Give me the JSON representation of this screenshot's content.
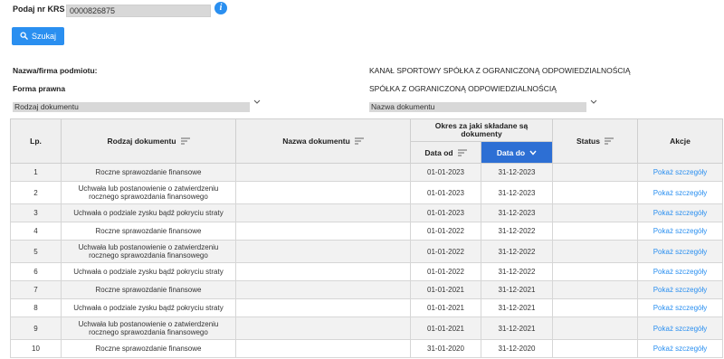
{
  "search": {
    "krs_label": "Podaj nr KRS",
    "krs_value": "0000826875",
    "info_glyph": "i",
    "button_label": "Szukaj"
  },
  "entity": {
    "name_label": "Nazwa/firma podmiotu:",
    "name_value": "KANAŁ SPORTOWY SPÓŁKA Z OGRANICZONĄ ODPOWIEDZIALNOŚCIĄ",
    "legal_form_label": "Forma prawna",
    "legal_form_value": "SPÓŁKA Z OGRANICZONĄ ODPOWIEDZIALNOŚCIĄ"
  },
  "filters": {
    "document_type": "Rodzaj dokumentu",
    "document_name": "Nazwa dokumentu"
  },
  "table": {
    "headers": {
      "lp": "Lp.",
      "type": "Rodzaj dokumentu",
      "name": "Nazwa dokumentu",
      "period": "Okres za jaki składane są dokumenty",
      "date_from": "Data od",
      "date_to": "Data do",
      "status": "Status",
      "actions": "Akcje"
    },
    "rows": [
      {
        "lp": "1",
        "type": "Roczne sprawozdanie finansowe",
        "name": "",
        "date_from": "01-01-2023",
        "date_to": "31-12-2023",
        "status": "",
        "action": "Pokaż szczegóły"
      },
      {
        "lp": "2",
        "type": "Uchwała lub postanowienie o zatwierdzeniu rocznego sprawozdania finansowego",
        "name": "",
        "date_from": "01-01-2023",
        "date_to": "31-12-2023",
        "status": "",
        "action": "Pokaż szczegóły"
      },
      {
        "lp": "3",
        "type": "Uchwała o podziale zysku bądź pokryciu straty",
        "name": "",
        "date_from": "01-01-2023",
        "date_to": "31-12-2023",
        "status": "",
        "action": "Pokaż szczegóły"
      },
      {
        "lp": "4",
        "type": "Roczne sprawozdanie finansowe",
        "name": "",
        "date_from": "01-01-2022",
        "date_to": "31-12-2022",
        "status": "",
        "action": "Pokaż szczegóły"
      },
      {
        "lp": "5",
        "type": "Uchwała lub postanowienie o zatwierdzeniu rocznego sprawozdania finansowego",
        "name": "",
        "date_from": "01-01-2022",
        "date_to": "31-12-2022",
        "status": "",
        "action": "Pokaż szczegóły"
      },
      {
        "lp": "6",
        "type": "Uchwała o podziale zysku bądź pokryciu straty",
        "name": "",
        "date_from": "01-01-2022",
        "date_to": "31-12-2022",
        "status": "",
        "action": "Pokaż szczegóły"
      },
      {
        "lp": "7",
        "type": "Roczne sprawozdanie finansowe",
        "name": "",
        "date_from": "01-01-2021",
        "date_to": "31-12-2021",
        "status": "",
        "action": "Pokaż szczegóły"
      },
      {
        "lp": "8",
        "type": "Uchwała o podziale zysku bądź pokryciu straty",
        "name": "",
        "date_from": "01-01-2021",
        "date_to": "31-12-2021",
        "status": "",
        "action": "Pokaż szczegóły"
      },
      {
        "lp": "9",
        "type": "Uchwała lub postanowienie o zatwierdzeniu rocznego sprawozdania finansowego",
        "name": "",
        "date_from": "01-01-2021",
        "date_to": "31-12-2021",
        "status": "",
        "action": "Pokaż szczegóły"
      },
      {
        "lp": "10",
        "type": "Roczne sprawozdanie finansowe",
        "name": "",
        "date_from": "31-01-2020",
        "date_to": "31-12-2020",
        "status": "",
        "action": "Pokaż szczegóły"
      }
    ]
  },
  "colors": {
    "accent": "#2a8ff0",
    "active_header": "#2d6fd4"
  }
}
